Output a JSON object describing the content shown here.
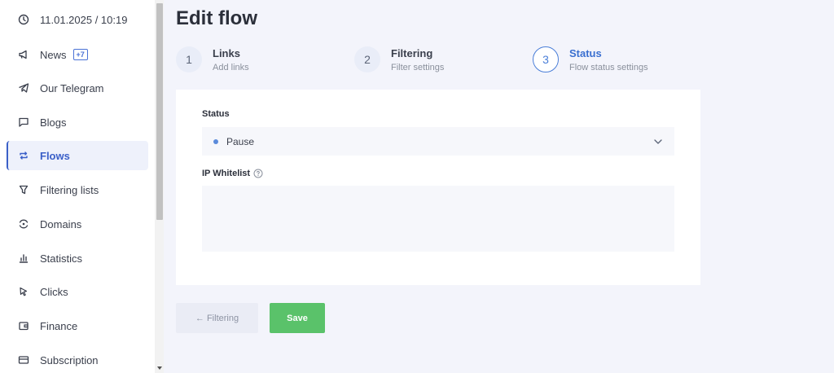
{
  "sidebar": {
    "items": [
      {
        "label": "11.01.2025 / 10:19",
        "icon": "clock-icon"
      },
      {
        "label": "News",
        "icon": "megaphone-icon",
        "badge": "+7"
      },
      {
        "label": "Our Telegram",
        "icon": "telegram-icon"
      },
      {
        "label": "Blogs",
        "icon": "chat-icon"
      },
      {
        "label": "Flows",
        "icon": "repeat-icon",
        "active": true
      },
      {
        "label": "Filtering lists",
        "icon": "filter-icon"
      },
      {
        "label": "Domains",
        "icon": "domains-icon"
      },
      {
        "label": "Statistics",
        "icon": "bar-chart-icon"
      },
      {
        "label": "Clicks",
        "icon": "cursor-icon"
      },
      {
        "label": "Finance",
        "icon": "wallet-icon"
      },
      {
        "label": "Subscription",
        "icon": "card-icon"
      }
    ]
  },
  "page": {
    "title": "Edit flow"
  },
  "steps": [
    {
      "number": "1",
      "title": "Links",
      "subtitle": "Add links"
    },
    {
      "number": "2",
      "title": "Filtering",
      "subtitle": "Filter settings"
    },
    {
      "number": "3",
      "title": "Status",
      "subtitle": "Flow status settings",
      "active": true
    }
  ],
  "form": {
    "status_label": "Status",
    "status_value": "Pause",
    "ip_whitelist_label": "IP Whitelist",
    "ip_whitelist_value": ""
  },
  "buttons": {
    "back_label": "← Filtering",
    "save_label": "Save"
  },
  "colors": {
    "accent": "#3a6fd0",
    "save": "#5ac26a",
    "background": "#f3f4fb"
  }
}
